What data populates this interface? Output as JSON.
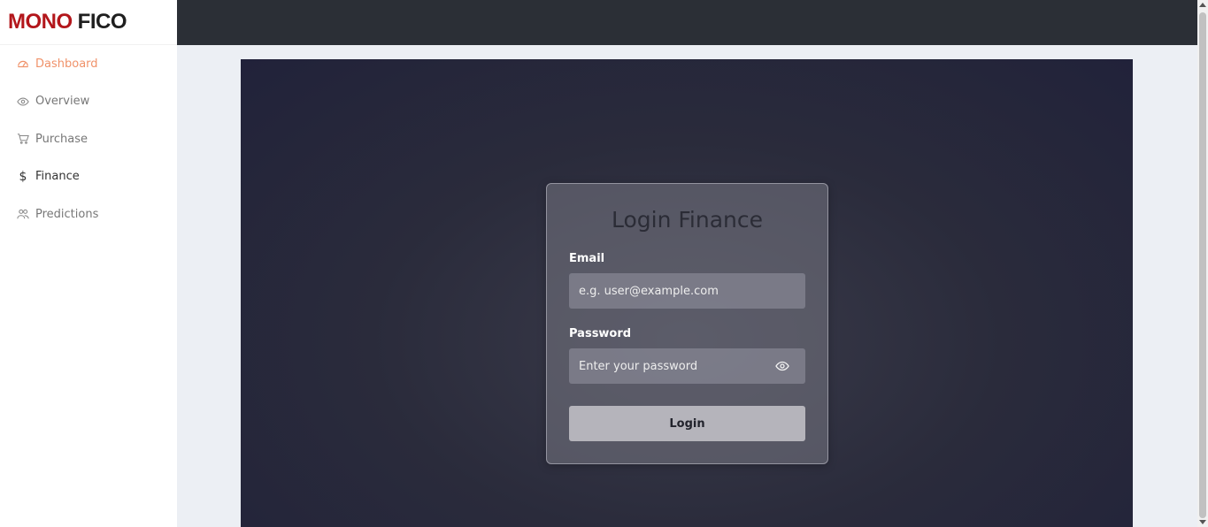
{
  "brand": {
    "part1": "MONO",
    "part2": "FICO",
    "part1_color": "#b3161b",
    "part2_color": "#1f1f1f"
  },
  "sidebar": {
    "items": [
      {
        "label": "Dashboard",
        "icon": "speedometer-icon",
        "state": "active"
      },
      {
        "label": "Overview",
        "icon": "eye-icon",
        "state": "default"
      },
      {
        "label": "Purchase",
        "icon": "cart-icon",
        "state": "default"
      },
      {
        "label": "Finance",
        "icon": "dollar-icon",
        "state": "current"
      },
      {
        "label": "Predictions",
        "icon": "people-icon",
        "state": "default"
      }
    ],
    "active_color": "#f0926a"
  },
  "topbar": {
    "background": "#2b2f36"
  },
  "login": {
    "title": "Login Finance",
    "email_label": "Email",
    "email_placeholder": "e.g. user@example.com",
    "password_label": "Password",
    "password_placeholder": "Enter your password",
    "toggle_icon": "eye-icon",
    "submit_label": "Login"
  }
}
